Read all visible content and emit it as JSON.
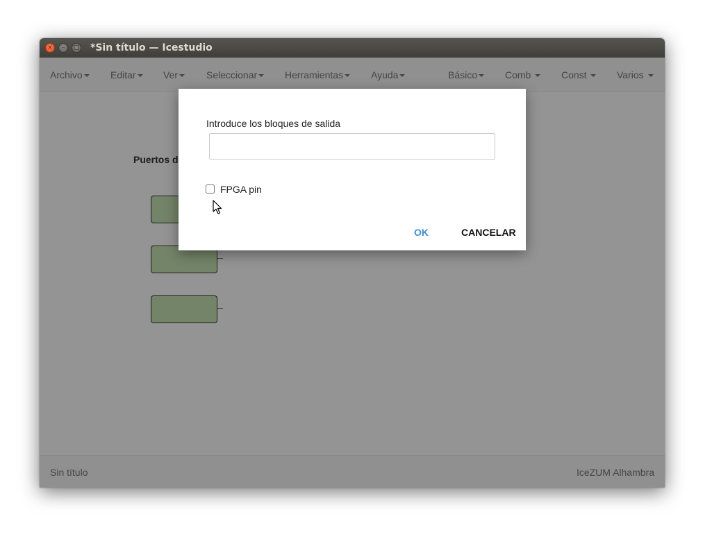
{
  "window": {
    "title": "*Sin título — Icestudio",
    "controls": {
      "close": "×",
      "minimize": "–",
      "maximize": "□"
    }
  },
  "menubar": {
    "left": [
      {
        "label": "Archivo"
      },
      {
        "label": "Editar"
      },
      {
        "label": "Ver"
      },
      {
        "label": "Seleccionar"
      },
      {
        "label": "Herramientas"
      },
      {
        "label": "Ayuda"
      }
    ],
    "right": [
      {
        "label": "Básico"
      },
      {
        "label": "Comb "
      },
      {
        "label": "Const "
      },
      {
        "label": "Varios "
      }
    ]
  },
  "canvas": {
    "section_label": "Puertos d",
    "block_color": "#c9e4b4"
  },
  "footer": {
    "left": "Sin título",
    "right": "IceZUM Alhambra"
  },
  "dialog": {
    "prompt": "Introduce los bloques de salida",
    "input_value": "",
    "checkbox_label": "FPGA pin",
    "checkbox_checked": false,
    "ok_label": "OK",
    "cancel_label": "CANCELAR",
    "ok_color": "#3a8fd0"
  }
}
